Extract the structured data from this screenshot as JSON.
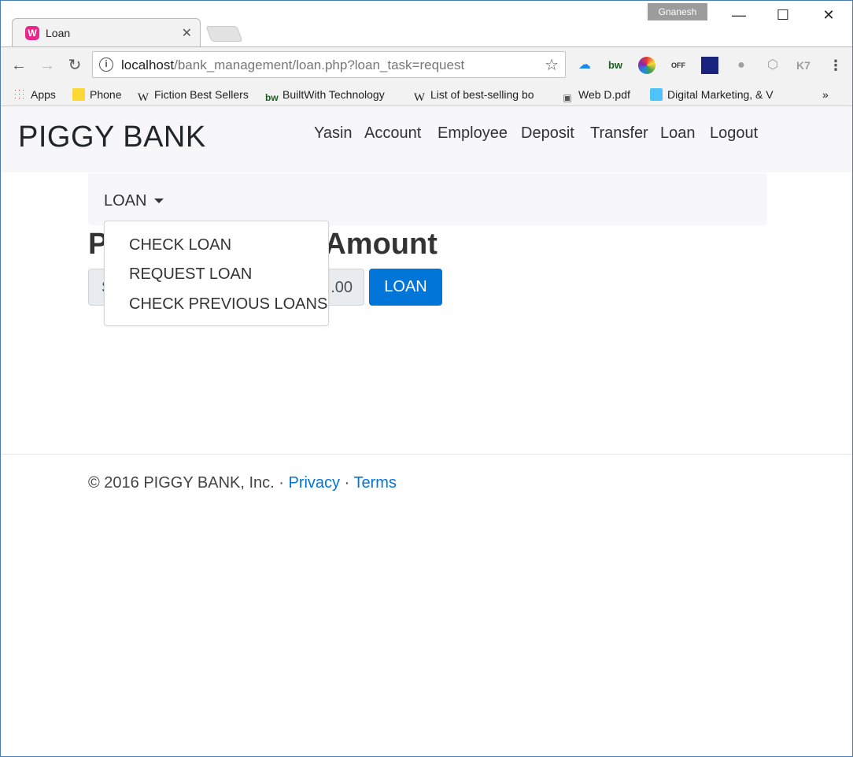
{
  "browser": {
    "tab_title": "Loan",
    "tab_favicon": "W",
    "profile_name": "Gnanesh",
    "url_host": "localhost",
    "url_path": "/bank_management/loan.php?loan_task=request",
    "extensions": [
      "cloud-icon",
      "bw-icon",
      "color-wheel-icon",
      "off-icon",
      "image-icon",
      "globe-icon",
      "cube-icon",
      "k7-icon",
      "menu-icon"
    ]
  },
  "bookmarks": {
    "apps": "Apps",
    "phone": "Phone",
    "fiction": "Fiction Best Sellers",
    "builtwith": "BuiltWith Technology",
    "list": "List of best-selling bo",
    "webd": "Web D.pdf",
    "digital": "Digital Marketing, & V",
    "more": "»"
  },
  "navbar": {
    "brand": "PIGGY BANK",
    "links": [
      "Yasin",
      "Account",
      "Employee",
      "Deposit",
      "Transfer",
      "Loan",
      "Logout"
    ]
  },
  "subnav": {
    "toggle_label": "LOAN"
  },
  "dropdown": {
    "items": [
      "CHECK LOAN",
      "REQUEST LOAN",
      "CHECK PREVIOUS LOANS"
    ]
  },
  "main": {
    "heading_start": "P",
    "heading_end": "Amount",
    "amount_prefix": "S",
    "amount_suffix": ".00",
    "submit_label": "LOAN"
  },
  "footer": {
    "copyright": "© 2016 PIGGY BANK, Inc. · ",
    "privacy": "Privacy",
    "sep": " · ",
    "terms": "Terms"
  },
  "colors": {
    "primary": "#0275d8",
    "navbar_bg": "#f7f7f9",
    "favicon": "#e6288a"
  }
}
